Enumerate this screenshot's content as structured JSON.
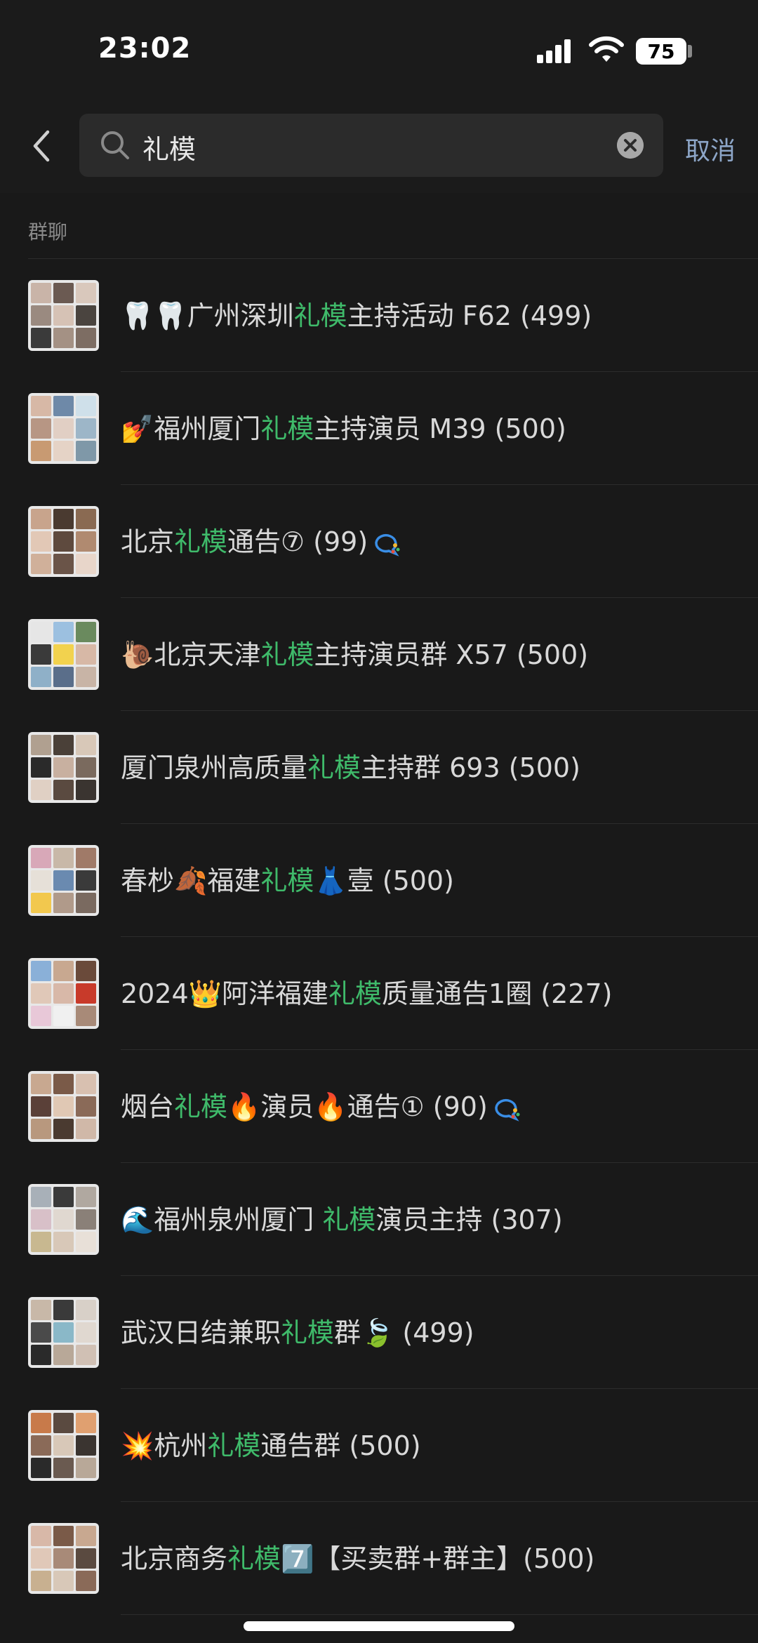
{
  "status_bar": {
    "time": "23:02",
    "battery": "75"
  },
  "search": {
    "query": "礼模",
    "cancel_label": "取消"
  },
  "section_title": "群聊",
  "colors": {
    "highlight": "#3fba6a",
    "cancel": "#8da6c8",
    "background": "#191919"
  },
  "groups": [
    {
      "pre": "🦷🦷广州深圳",
      "hl": "礼模",
      "post": "主持活动 F62 (499)",
      "badge": false,
      "avatar": [
        "#c9b4a8",
        "#6b5a52",
        "#d9c8bc",
        "#9a8a80",
        "#d6c2b5",
        "#4a443f",
        "#3a3a3a",
        "#a49184",
        "#7d6d63"
      ]
    },
    {
      "pre": "💅福州厦门",
      "hl": "礼模",
      "post": "主持演员 M39 (500)",
      "badge": false,
      "avatar": [
        "#d7b8a6",
        "#6e89a8",
        "#cfe0ea",
        "#b79684",
        "#e1cfc4",
        "#9db6c8",
        "#c89a72",
        "#e5d3c6",
        "#7f98a8"
      ]
    },
    {
      "pre": "北京",
      "hl": "礼模",
      "post": "通告⑦ (99)",
      "badge": true,
      "avatar": [
        "#c8a48c",
        "#4a3a30",
        "#8a6a52",
        "#e2c8b6",
        "#5e4a3e",
        "#b08a70",
        "#d0b09a",
        "#6a5448",
        "#e8d6ca"
      ]
    },
    {
      "pre": "🐌北京天津",
      "hl": "礼模",
      "post": "主持演员群 X57 (500)",
      "badge": false,
      "avatar": [
        "#e6e6e6",
        "#9cc0e0",
        "#6a8a5e",
        "#3a3a3a",
        "#f2d24e",
        "#d7b8a6",
        "#8fb0c8",
        "#5a6e8a",
        "#c8b4a6"
      ]
    },
    {
      "pre": "厦门泉州高质量",
      "hl": "礼模",
      "post": "主持群 693 (500)",
      "badge": false,
      "avatar": [
        "#b0a090",
        "#4a4038",
        "#d8c8b8",
        "#2a2a2a",
        "#c8b0a0",
        "#7a6a5e",
        "#e0d0c4",
        "#5a4a40",
        "#3a3430"
      ]
    },
    {
      "pre": "春杪🍂福建",
      "hl": "礼模",
      "post": "👗壹 (500)",
      "badge": false,
      "avatar": [
        "#d8a8b8",
        "#c8b8a8",
        "#a07a68",
        "#e6e0d8",
        "#6a8ab0",
        "#3a3a3a",
        "#f2c84e",
        "#b09a8a",
        "#7a6a60"
      ]
    },
    {
      "pre": "2024👑阿洋福建",
      "hl": "礼模",
      "post": "质量通告1圈 (227)",
      "badge": false,
      "avatar": [
        "#8ab0d8",
        "#c8a890",
        "#6a4a3a",
        "#e0c8b8",
        "#d8b8a8",
        "#c83a2a",
        "#e8c8d8",
        "#f0f0f0",
        "#a88a78"
      ]
    },
    {
      "pre": "烟台",
      "hl": "礼模",
      "post": "🔥演员🔥通告① (90)",
      "badge": true,
      "avatar": [
        "#c8a890",
        "#7a5a48",
        "#d8c0b0",
        "#5a4038",
        "#e0c8b4",
        "#8a6a58",
        "#b8987e",
        "#4a3a30",
        "#d0b8a8"
      ]
    },
    {
      "pre": "🌊福州泉州厦门 ",
      "hl": "礼模",
      "post": "演员主持 (307)",
      "badge": false,
      "avatar": [
        "#a8b0b8",
        "#3a3a3a",
        "#b0a8a0",
        "#d8c0c8",
        "#e0d8d0",
        "#8a8078",
        "#c8b890",
        "#d8c8b8",
        "#e8e0d8"
      ]
    },
    {
      "pre": "武汉日结兼职",
      "hl": "礼模",
      "post": "群🍃 (499)",
      "badge": false,
      "avatar": [
        "#c8b8a8",
        "#3a3a3a",
        "#d8d0c8",
        "#4a4a4a",
        "#8ab8c8",
        "#e0d8d0",
        "#2a2a2a",
        "#b8a898",
        "#d0c0b4"
      ]
    },
    {
      "pre": "💥杭州",
      "hl": "礼模",
      "post": "通告群 (500)",
      "badge": false,
      "avatar": [
        "#c87a4a",
        "#5a4a40",
        "#e0a070",
        "#8a6a58",
        "#d8c8b8",
        "#3a3430",
        "#2a2a2a",
        "#6a5a50",
        "#b8a898"
      ]
    },
    {
      "pre": "北京商务",
      "hl": "礼模",
      "post": "7️⃣【买卖群+群主】(500)",
      "badge": false,
      "avatar": [
        "#d8b8a8",
        "#7a5a48",
        "#c8a890",
        "#e0c8b8",
        "#a88a78",
        "#5a4a40",
        "#c8b090",
        "#d8c8b8",
        "#8a6a58"
      ]
    }
  ]
}
